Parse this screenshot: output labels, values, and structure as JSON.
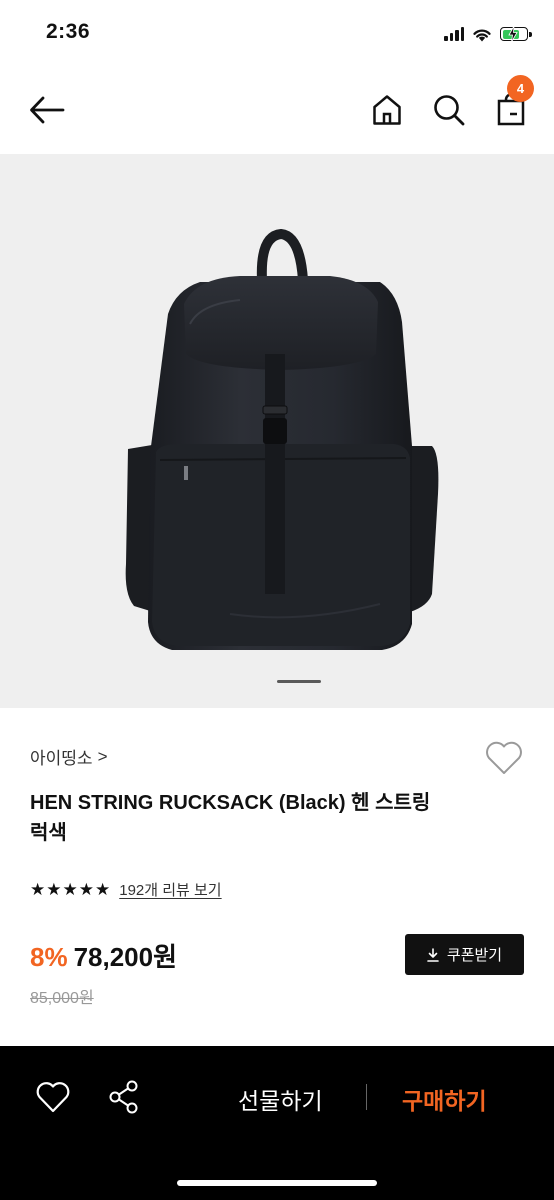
{
  "status_bar": {
    "time": "2:36",
    "icons": [
      "cellular-signal-icon",
      "wifi-icon",
      "battery-charging-icon"
    ],
    "battery_color": "#34c759"
  },
  "header": {
    "icons": [
      "back-arrow-icon",
      "home-icon",
      "search-icon",
      "shopping-bag-icon"
    ],
    "cart_count": "4",
    "badge_color": "#f26522"
  },
  "gallery": {
    "image": "black-backpack-photo",
    "background": "#efefef"
  },
  "product": {
    "brand": "아이띵소",
    "brand_chevron": ">",
    "title": "HEN STRING RUCKSACK (Black) 헨 스트링 럭색",
    "rating_stars": 5,
    "review_link": "192개 리뷰 보기",
    "discount": "8%",
    "price": "78,200원",
    "original_price": "85,000원",
    "coupon_button": "쿠폰받기"
  },
  "bottom_bar": {
    "gift": "선물하기",
    "buy": "구매하기",
    "accent_color": "#f26522",
    "icons": [
      "heart-outline-icon",
      "share-icon"
    ]
  }
}
